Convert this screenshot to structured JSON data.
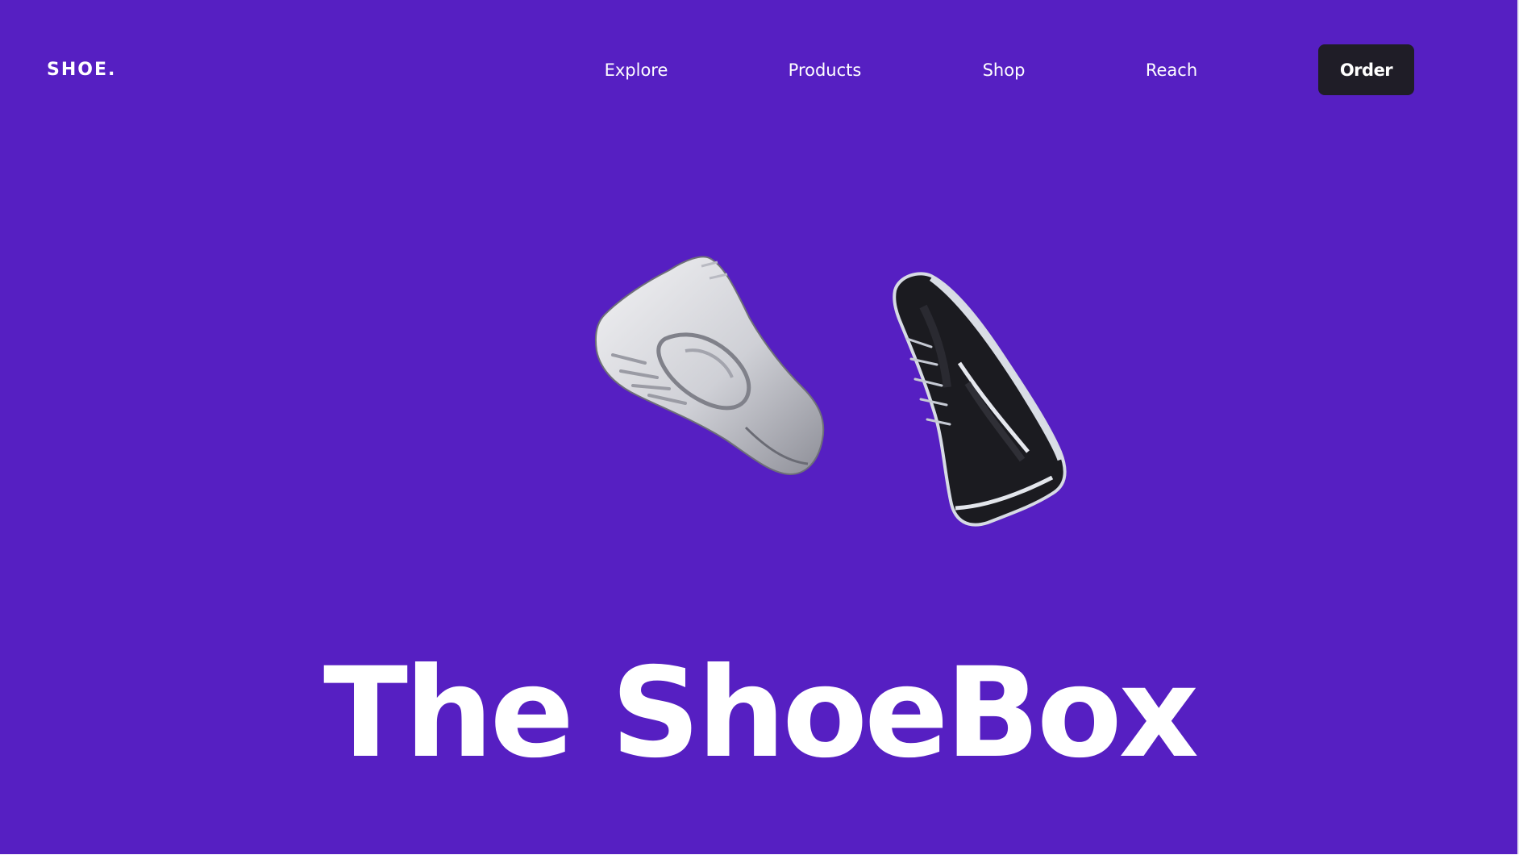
{
  "brand": {
    "logo_text": "SHOE."
  },
  "nav": {
    "links": [
      {
        "label": "Explore"
      },
      {
        "label": "Products"
      },
      {
        "label": "Shop"
      },
      {
        "label": "Reach"
      }
    ],
    "order_label": "Order"
  },
  "hero": {
    "title": "The ShoeBox",
    "images": [
      {
        "icon": "white-sneaker-image"
      },
      {
        "icon": "black-sneaker-image"
      }
    ]
  },
  "colors": {
    "background": "#561fc2",
    "text": "#ffffff",
    "button": "#1f1d27"
  }
}
